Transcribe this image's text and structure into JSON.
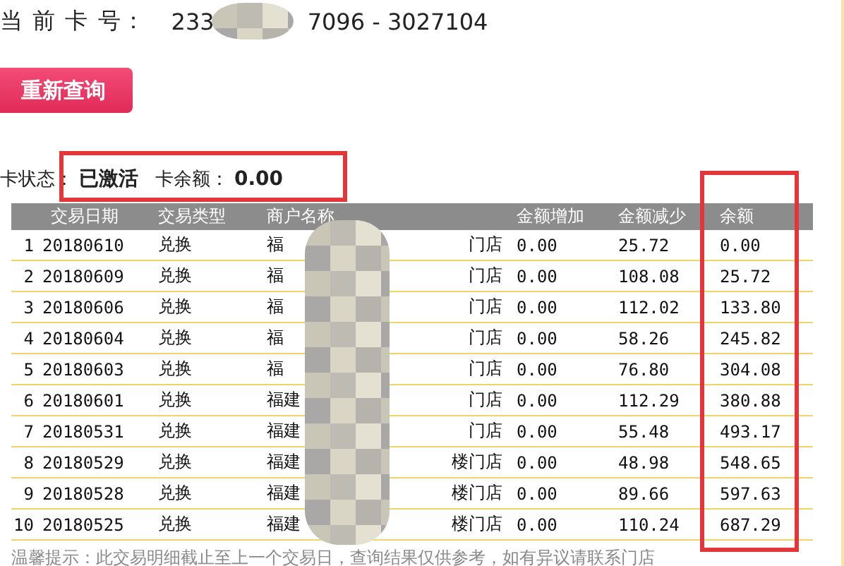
{
  "card": {
    "label": "当 前 卡 号：",
    "number_start": "233",
    "number_end": "7096 - 3027104"
  },
  "requery_button": "重新查询",
  "status": {
    "label": "卡状态：",
    "value": "已激活",
    "balance_label": "卡余额：",
    "balance": "0.00"
  },
  "table": {
    "columns": [
      "",
      "交易日期",
      "交易类型",
      "商户名称",
      "金额增加",
      "金额减少",
      "余额"
    ],
    "rows": [
      {
        "index": "1",
        "date": "20180610",
        "type": "兑换",
        "merchant_start": "福",
        "merchant_end": "门店",
        "increase": "0.00",
        "decrease": "25.72",
        "balance": "0.00"
      },
      {
        "index": "2",
        "date": "20180609",
        "type": "兑换",
        "merchant_start": "福",
        "merchant_end": "门店",
        "increase": "0.00",
        "decrease": "108.08",
        "balance": "25.72"
      },
      {
        "index": "3",
        "date": "20180606",
        "type": "兑换",
        "merchant_start": "福",
        "merchant_end": "门店",
        "increase": "0.00",
        "decrease": "112.02",
        "balance": "133.80"
      },
      {
        "index": "4",
        "date": "20180604",
        "type": "兑换",
        "merchant_start": "福",
        "merchant_end": "门店",
        "increase": "0.00",
        "decrease": "58.26",
        "balance": "245.82"
      },
      {
        "index": "5",
        "date": "20180603",
        "type": "兑换",
        "merchant_start": "福",
        "merchant_end": "门店",
        "increase": "0.00",
        "decrease": "76.80",
        "balance": "304.08"
      },
      {
        "index": "6",
        "date": "20180601",
        "type": "兑换",
        "merchant_start": "福建",
        "merchant_end": "门店",
        "increase": "0.00",
        "decrease": "112.29",
        "balance": "380.88"
      },
      {
        "index": "7",
        "date": "20180531",
        "type": "兑换",
        "merchant_start": "福建",
        "merchant_end": "门店",
        "increase": "0.00",
        "decrease": "55.48",
        "balance": "493.17"
      },
      {
        "index": "8",
        "date": "20180529",
        "type": "兑换",
        "merchant_start": "福建",
        "merchant_end": "楼门店",
        "increase": "0.00",
        "decrease": "48.98",
        "balance": "548.65"
      },
      {
        "index": "9",
        "date": "20180528",
        "type": "兑换",
        "merchant_start": "福建",
        "merchant_end": "楼门店",
        "increase": "0.00",
        "decrease": "89.66",
        "balance": "597.63"
      },
      {
        "index": "10",
        "date": "20180525",
        "type": "兑换",
        "merchant_start": "福建",
        "merchant_end": "楼门店",
        "increase": "0.00",
        "decrease": "110.24",
        "balance": "687.29"
      }
    ]
  },
  "note": "温馨提示：此交易明细截止至上一个交易日，查询结果仅供参考，如有异议请联系门店"
}
